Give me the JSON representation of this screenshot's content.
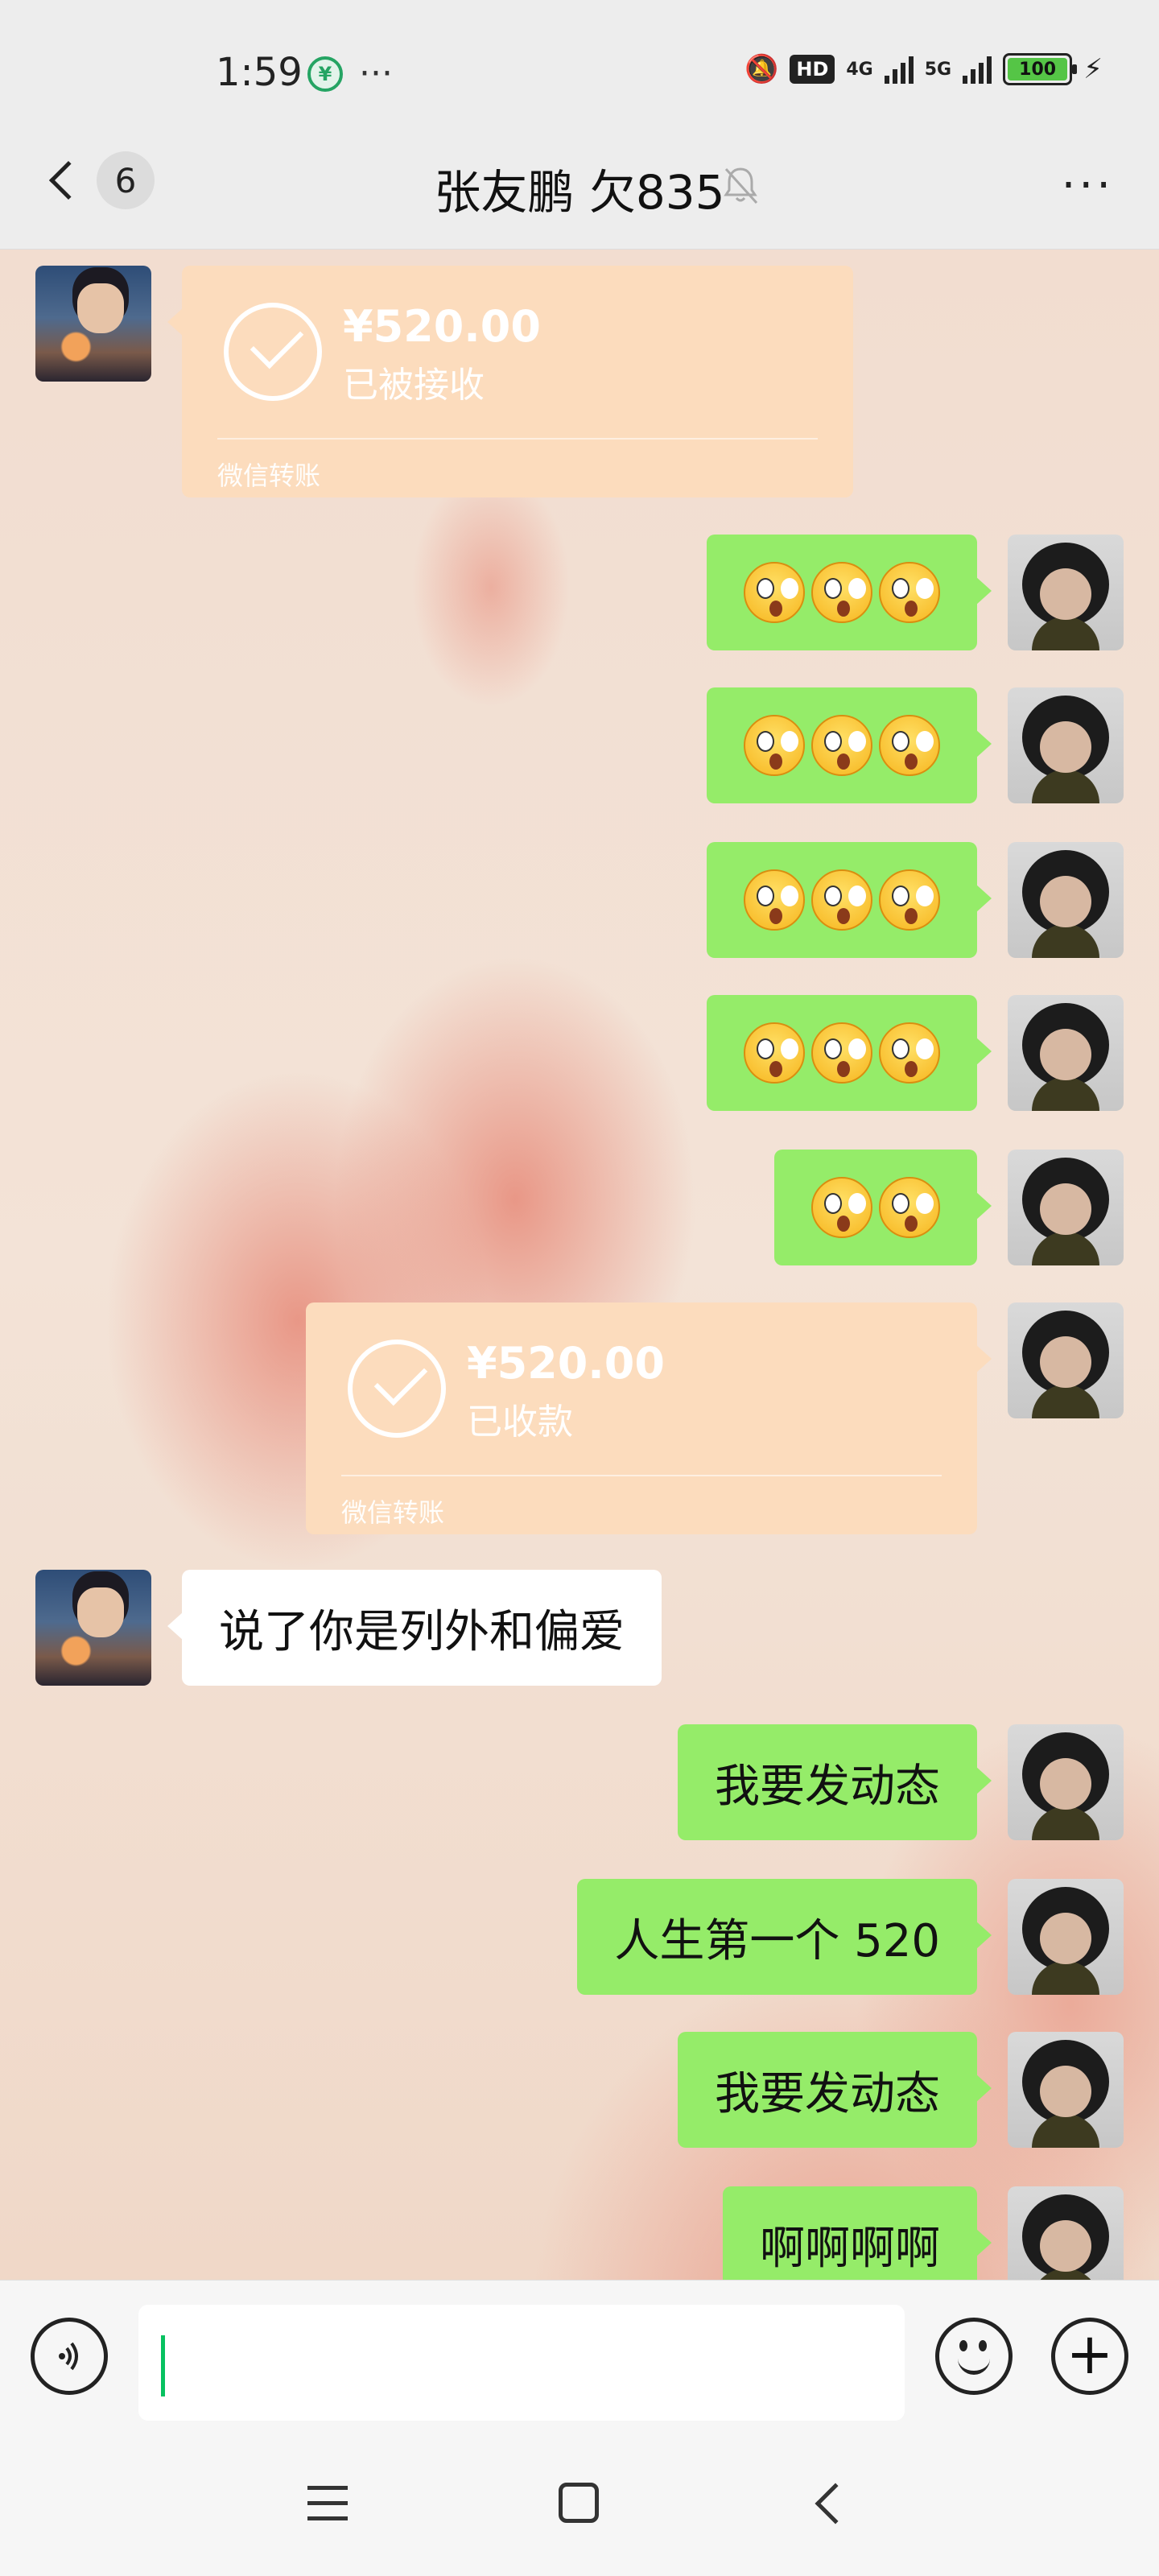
{
  "status_bar": {
    "time": "1:59",
    "hd_label": "HD",
    "network_1": "4G",
    "network_2": "5G",
    "battery": "100"
  },
  "header": {
    "back_badge": "6",
    "title": "张友鹏 欠835",
    "more_label": "···"
  },
  "messages": [
    {
      "side": "other",
      "type": "transfer",
      "amount": "¥520.00",
      "status": "已被接收",
      "label": "微信转账"
    },
    {
      "side": "me",
      "type": "emoji",
      "count": 3
    },
    {
      "side": "me",
      "type": "emoji",
      "count": 3
    },
    {
      "side": "me",
      "type": "emoji",
      "count": 3
    },
    {
      "side": "me",
      "type": "emoji",
      "count": 3
    },
    {
      "side": "me",
      "type": "emoji",
      "count": 2
    },
    {
      "side": "me",
      "type": "transfer",
      "amount": "¥520.00",
      "status": "已收款",
      "label": "微信转账"
    },
    {
      "side": "other",
      "type": "text",
      "text": "说了你是列外和偏爱"
    },
    {
      "side": "me",
      "type": "text",
      "text": "我要发动态"
    },
    {
      "side": "me",
      "type": "text",
      "text": "人生第一个 520"
    },
    {
      "side": "me",
      "type": "text",
      "text": "我要发动态"
    },
    {
      "side": "me",
      "type": "text",
      "text": "啊啊啊啊"
    }
  ],
  "input_bar": {
    "value": "",
    "plus_label": "+"
  },
  "colors": {
    "my_bubble": "#95ec69",
    "their_bubble": "#ffffff",
    "transfer_card": "#fcdcbd",
    "caret": "#07c160"
  }
}
